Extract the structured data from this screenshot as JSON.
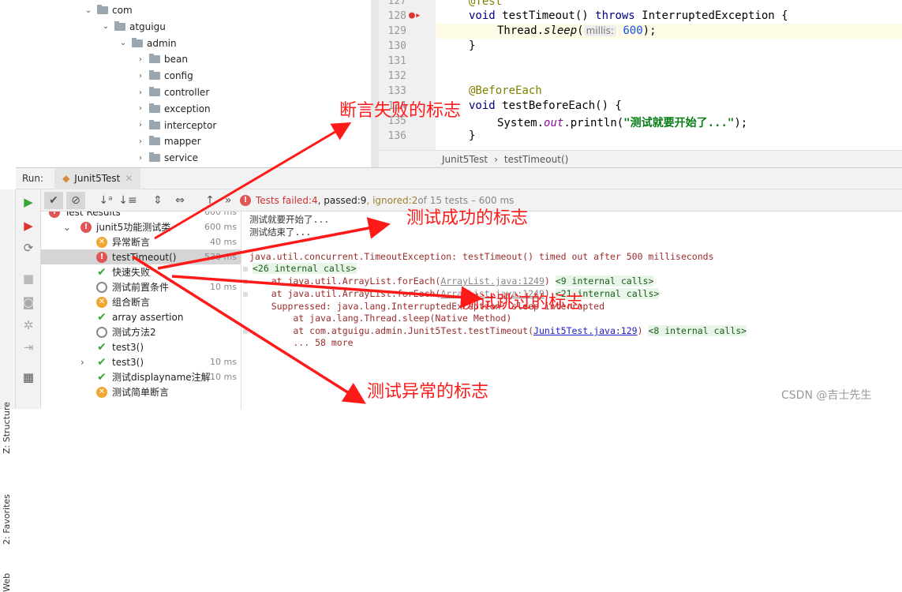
{
  "project_tree": {
    "items": [
      {
        "label": "com",
        "level": 0,
        "expanded": true
      },
      {
        "label": "atguigu",
        "level": 1,
        "expanded": true
      },
      {
        "label": "admin",
        "level": 2,
        "expanded": true
      },
      {
        "label": "bean",
        "level": 3
      },
      {
        "label": "config",
        "level": 3
      },
      {
        "label": "controller",
        "level": 3
      },
      {
        "label": "exception",
        "level": 3
      },
      {
        "label": "interceptor",
        "level": 3
      },
      {
        "label": "mapper",
        "level": 3
      },
      {
        "label": "service",
        "level": 3
      }
    ]
  },
  "editor": {
    "lines": [
      "127",
      "128",
      "129",
      "130",
      "131",
      "132",
      "133",
      "134",
      "135",
      "136"
    ],
    "code": {
      "l127": "@Test",
      "l128_void": "void",
      "l128_name": " testTimeout() ",
      "l128_throws": "throws",
      "l128_rest": " InterruptedException {",
      "l129_a": "Thread.",
      "l129_sleep": "sleep",
      "l129_paren": "(",
      "l129_hint": "millis:",
      "l129_num": "600",
      "l129_end": ");",
      "l130": "}",
      "l133": "@BeforeEach",
      "l134_void": "void",
      "l134_rest": " testBeforeEach() {",
      "l135_a": "System.",
      "l135_out": "out",
      "l135_b": ".println(",
      "l135_str": "\"测试就要开始了...\"",
      "l135_end": ");",
      "l136": "}"
    }
  },
  "breadcrumb": [
    "Junit5Test",
    "testTimeout()"
  ],
  "run": {
    "label": "Run:",
    "tab": "Junit5Test"
  },
  "side_labels": [
    "Z: Structure",
    "2: Favorites",
    "Web"
  ],
  "status": {
    "failed_label": "Tests failed: ",
    "failed": "4",
    "passed_label": ", passed: ",
    "passed": "9",
    "ignored_label": ", ignored: ",
    "ignored": "2",
    "rest": " of 15 tests – 600 ms"
  },
  "results": [
    {
      "label": "Test Results",
      "status": "fail",
      "time": "600 ms"
    },
    {
      "label": "junit5功能测试类",
      "status": "fail",
      "time": "600 ms"
    },
    {
      "label": "异常断言",
      "status": "error",
      "time": "40 ms"
    },
    {
      "label": "testTimeout()",
      "status": "fail",
      "time": "530 ms"
    },
    {
      "label": "快速失败",
      "status": "pass",
      "time": ""
    },
    {
      "label": "测试前置条件",
      "status": "skip",
      "time": "10 ms"
    },
    {
      "label": "组合断言",
      "status": "error",
      "time": ""
    },
    {
      "label": "array assertion",
      "status": "pass",
      "time": ""
    },
    {
      "label": "测试方法2",
      "status": "skip",
      "time": ""
    },
    {
      "label": "test3()",
      "status": "pass",
      "time": ""
    },
    {
      "label": "test3()",
      "status": "pass",
      "time": "10 ms"
    },
    {
      "label": "测试displayname注解",
      "status": "pass",
      "time": "10 ms"
    },
    {
      "label": "测试简单断言",
      "status": "error",
      "time": ""
    }
  ],
  "console": {
    "out1": "测试就要开始了...",
    "out2": "测试结束了...",
    "exception": "java.util.concurrent.TimeoutException: testTimeout() timed out after 500 milliseconds",
    "internal26": "<26 internal calls>",
    "at1": "    at java.util.ArrayList.forEach(",
    "at1_link": "ArrayList.java:1249",
    "at1_end": ")",
    "internal9": "<9 internal calls>",
    "at2": "    at java.util.ArrayList.forEach(",
    "at2_link": "ArrayList.java:1249",
    "at2_end": ")",
    "internal21": "<21 internal calls>",
    "suppressed": "    Suppressed: java.lang.InterruptedException: sleep interrupted",
    "at3": "        at java.lang.Thread.sleep(Native Method)",
    "at4": "        at com.atguigu.admin.Junit5Test.testTimeout(",
    "at4_link": "Junit5Test.java:129",
    "at4_end": ")",
    "internal8": "<8 internal calls>",
    "more": "        ... 58 more"
  },
  "annotations": {
    "a1": "断言失败的标志",
    "a2": "测试成功的标志",
    "a3": "测试跳过的标志",
    "a4": "测试异常的标志"
  },
  "watermark": "CSDN @吉士先生",
  "colors": {
    "annotation": "#ff1a1a",
    "fail": "#e05555",
    "error": "#f0a732",
    "pass": "#3aa73a"
  }
}
